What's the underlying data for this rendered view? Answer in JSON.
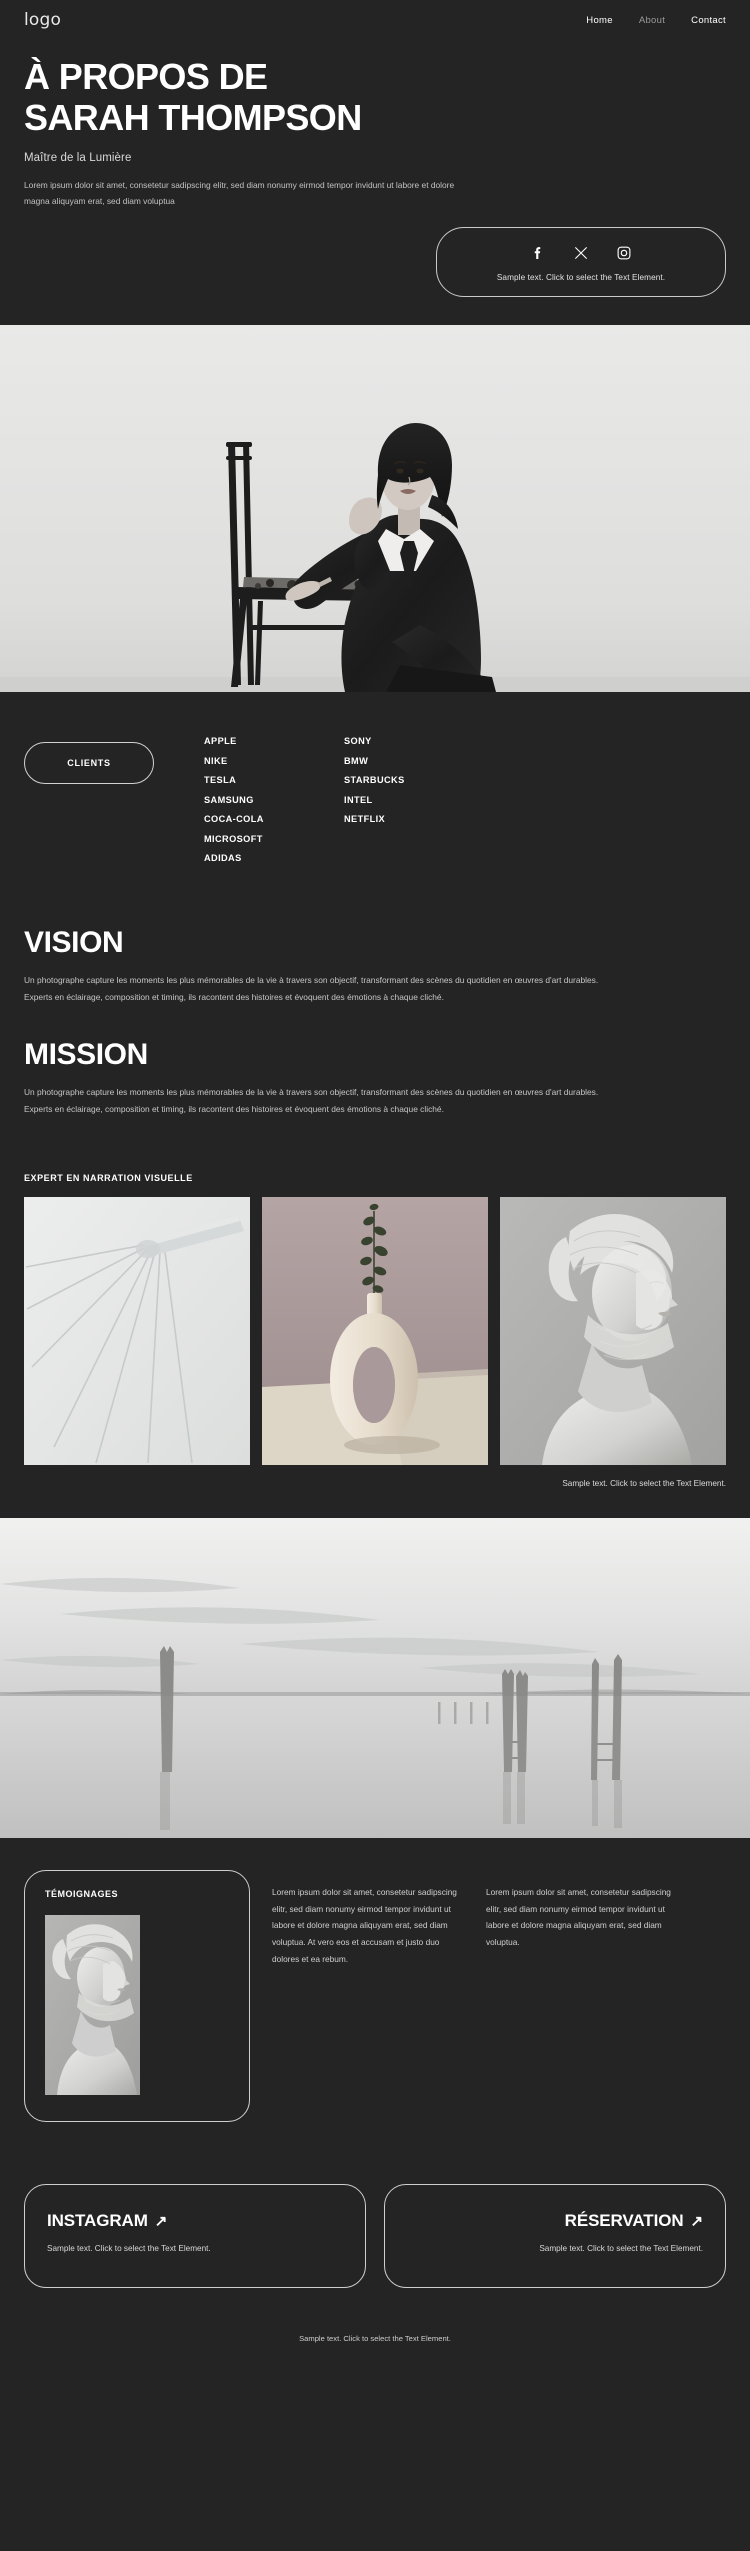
{
  "header": {
    "logo": "logo",
    "nav": [
      {
        "label": "Home",
        "state": "active"
      },
      {
        "label": "About",
        "state": "muted"
      },
      {
        "label": "Contact",
        "state": "active"
      }
    ]
  },
  "hero": {
    "title_line1": "À PROPOS DE",
    "title_line2": "SARAH THOMPSON",
    "subtitle": "Maître de la Lumière",
    "lead": "Lorem ipsum dolor sit amet, consetetur sadipscing elitr, sed diam nonumy eirmod tempor invidunt ut labore et dolore magna aliquyam erat, sed diam voluptua",
    "social": {
      "icons": [
        "facebook-icon",
        "x-twitter-icon",
        "instagram-icon"
      ],
      "caption": "Sample text. Click to select the Text Element."
    }
  },
  "clients": {
    "button_label": "CLIENTS",
    "column_left": [
      "APPLE",
      "NIKE",
      "TESLA",
      "SAMSUNG",
      "COCA-COLA",
      "MICROSOFT",
      "ADIDAS"
    ],
    "column_right": [
      "SONY",
      "BMW",
      "STARBUCKS",
      "INTEL",
      "NETFLIX"
    ]
  },
  "vision": {
    "title": "VISION",
    "body": "Un photographe capture les moments les plus mémorables de la vie à travers son objectif, transformant des scènes du quotidien en œuvres d'art durables. Experts en éclairage, composition et timing, ils racontent des histoires et évoquent des émotions à chaque cliché."
  },
  "mission": {
    "title": "MISSION",
    "body": "Un photographe capture les moments les plus mémorables de la vie à travers son objectif, transformant des scènes du quotidien en œuvres d'art durables. Experts en éclairage, composition et timing, ils racontent des histoires et évoquent des émotions à chaque cliché."
  },
  "gallery": {
    "eyebrow": "EXPERT EN NARRATION VISUELLE",
    "items": [
      {
        "alt": "lignes-abstraites-minimalistes"
      },
      {
        "alt": "vase-ceramique-avec-branche"
      },
      {
        "alt": "portrait-buste-drape-plastique"
      }
    ],
    "caption": "Sample text. Click to select the Text Element."
  },
  "landscape": {
    "alt": "pilotis-en-bois-sur-lac-calme-noir-et-blanc"
  },
  "testimonials": {
    "card_title": "TÉMOIGNAGES",
    "card_photo_alt": "portrait-buste-drape-plastique",
    "quotes": [
      "Lorem ipsum dolor sit amet, consetetur sadipscing elitr, sed diam nonumy eirmod tempor invidunt ut labore et dolore magna aliquyam erat, sed diam voluptua. At vero eos et accusam et justo duo dolores et ea rebum.",
      "Lorem ipsum dolor sit amet, consetetur sadipscing elitr, sed diam nonumy eirmod tempor invidunt ut labore et dolore magna aliquyam erat, sed diam voluptua."
    ]
  },
  "cta": {
    "instagram": {
      "title": "INSTAGRAM",
      "arrow": "↗",
      "text": "Sample text. Click to select the Text Element."
    },
    "reservation": {
      "title": "RÉSERVATION",
      "arrow": "↗",
      "text": "Sample text. Click to select the Text Element."
    }
  },
  "footer": {
    "text": "Sample text. Click to select the Text Element."
  },
  "colors": {
    "background": "#242424",
    "text": "#ffffff",
    "muted_text": "#c6c6c6",
    "border": "#cfcfcf"
  }
}
